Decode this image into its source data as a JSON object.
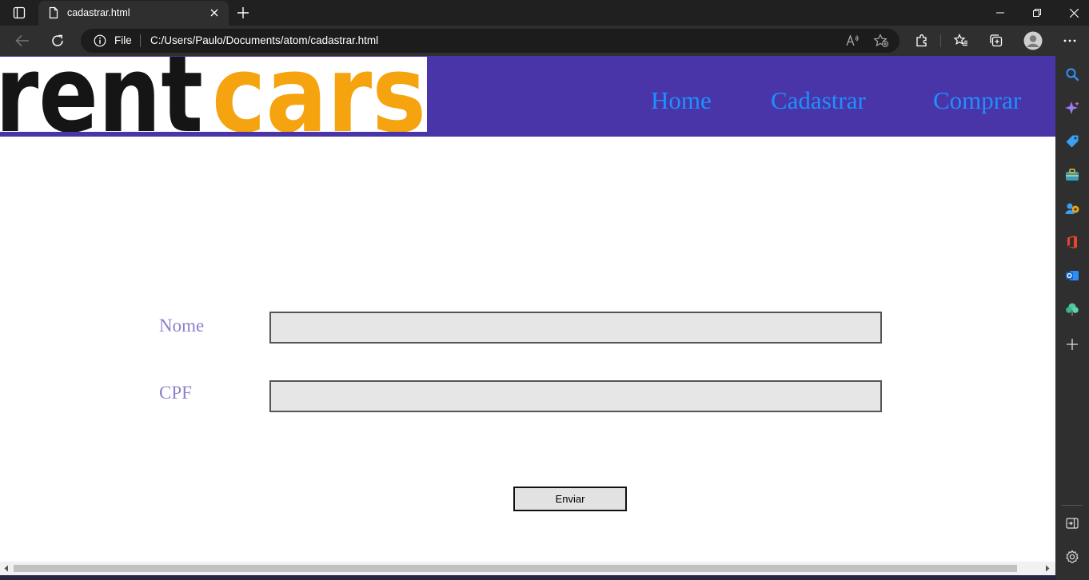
{
  "browser": {
    "tab_title": "cadastrar.html",
    "address_scheme": "File",
    "address_url": "C:/Users/Paulo/Documents/atom/cadastrar.html"
  },
  "site": {
    "logo": {
      "part1": "rent",
      "part2": "cars",
      "color1": "#151515",
      "color2": "#f5a40f"
    },
    "nav": [
      "Home",
      "Cadastrar",
      "Comprar"
    ],
    "header_color": "#4a35a8",
    "link_color": "#1e90ff"
  },
  "form": {
    "name_label": "Nome",
    "name_value": "",
    "cpf_label": "CPF",
    "cpf_value": "",
    "submit_label": "Enviar",
    "label_color": "#8b82cc"
  },
  "sidebar_icons": [
    "search-icon",
    "copilot-icon",
    "shopping-tag-icon",
    "tools-icon",
    "games-icon",
    "office-icon",
    "outlook-icon",
    "tree-icon",
    "add-icon",
    "split-screen-icon",
    "settings-icon"
  ]
}
